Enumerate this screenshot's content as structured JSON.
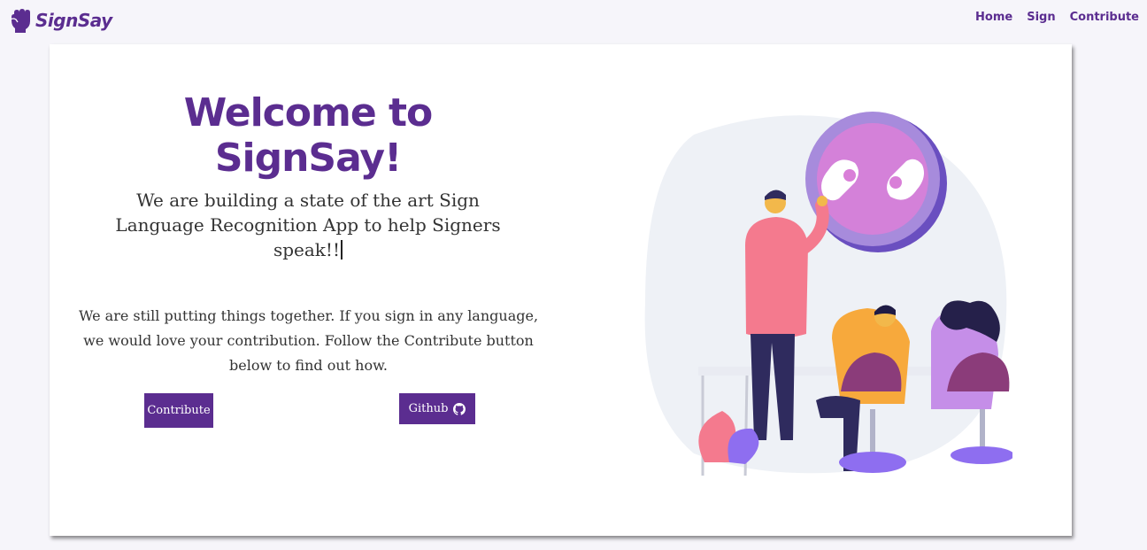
{
  "brand": {
    "name": "SignSay",
    "logo_icon": "raised-fist-icon"
  },
  "nav": {
    "items": [
      {
        "label": "Home"
      },
      {
        "label": "Sign"
      },
      {
        "label": "Contribute"
      }
    ]
  },
  "hero": {
    "title": "Welcome to SignSay!",
    "tagline": "We are building a state of the art Sign Language Recognition App to help Signers speak!!",
    "info": "We are still putting things together. If you sign in any language, we would love your contribution. Follow the Contribute button below to find out how."
  },
  "buttons": {
    "contribute_label": "Contribute",
    "github_label": "Github",
    "github_icon": "github-icon"
  },
  "colors": {
    "brand_purple": "#5b2d90",
    "page_background": "#f6f5fa",
    "card_background": "#ffffff"
  }
}
